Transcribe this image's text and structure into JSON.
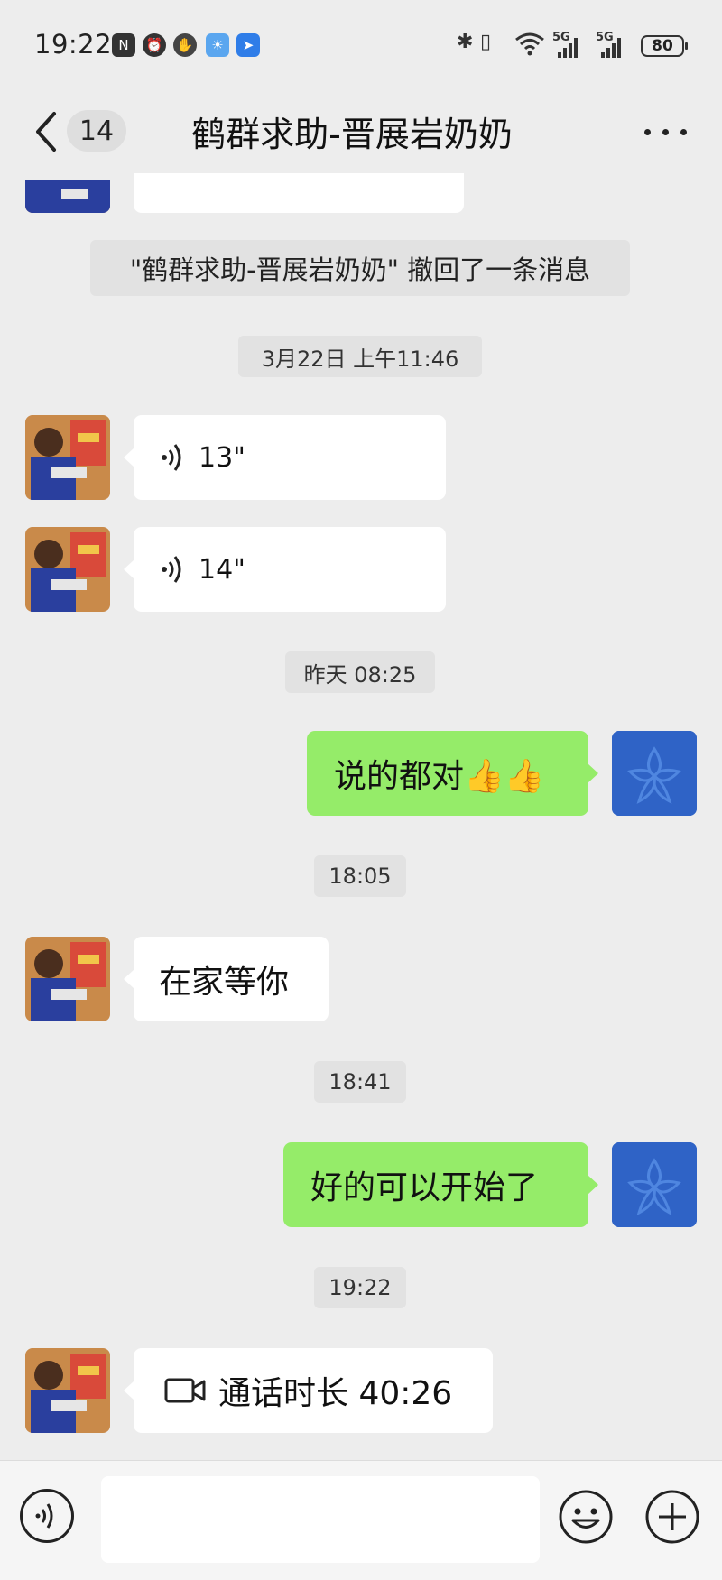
{
  "status_bar": {
    "time": "19:22",
    "network_1": "5G",
    "network_2": "5G",
    "battery": "80"
  },
  "nav": {
    "unread_count": "14",
    "title": "鹤群求助-晋展岩奶奶"
  },
  "messages": {
    "recall_notice": "\"鹤群求助-晋展岩奶奶\" 撤回了一条消息",
    "ts1": "3月22日 上午11:46",
    "voice1": "13\"",
    "voice2": "14\"",
    "ts2": "昨天 08:25",
    "out1": "说的都对👍👍",
    "ts3": "18:05",
    "in1": "在家等你",
    "ts4": "18:41",
    "out2": "好的可以开始了",
    "ts5": "19:22",
    "call": "通话时长 40:26"
  },
  "colors": {
    "bg": "#ededed",
    "out_bubble": "#95ec69",
    "in_bubble": "#ffffff",
    "self_avatar": "#2f63c6"
  }
}
